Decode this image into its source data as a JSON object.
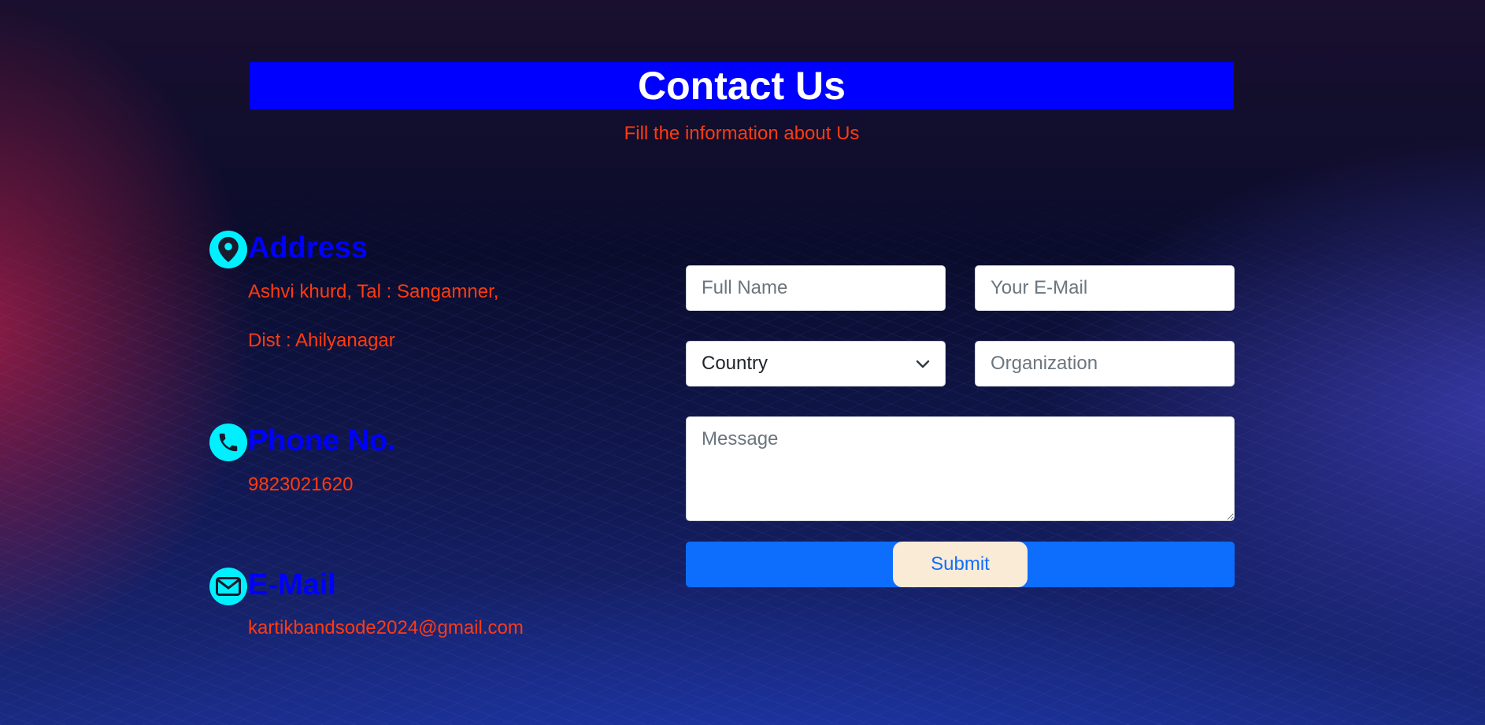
{
  "header": {
    "title": "Contact Us",
    "subtitle": "Fill the information about Us"
  },
  "contact_info": {
    "address": {
      "icon": "map-pin-icon",
      "heading": "Address",
      "line1": "Ashvi khurd, Tal : Sangamner,",
      "line2": "Dist : Ahilyanagar"
    },
    "phone": {
      "icon": "phone-icon",
      "heading": "Phone No.",
      "value": "9823021620"
    },
    "email": {
      "icon": "envelope-icon",
      "heading": "E-Mail",
      "value": "kartikbandsode2024@gmail.com"
    }
  },
  "form": {
    "full_name": {
      "placeholder": "Full Name",
      "value": ""
    },
    "email": {
      "placeholder": "Your E-Mail",
      "value": ""
    },
    "country": {
      "selected": "Country",
      "options": [
        "Country"
      ]
    },
    "organization": {
      "placeholder": "Organization",
      "value": ""
    },
    "message": {
      "placeholder": "Message",
      "value": ""
    },
    "submit_label": "Submit"
  },
  "colors": {
    "title_bar": "#0000ff",
    "accent_text": "#ff3b10",
    "heading_text": "#0000ff",
    "icon_circle": "#00f0ff",
    "submit_bar": "#0d6efd",
    "submit_button": "#faebd7"
  }
}
